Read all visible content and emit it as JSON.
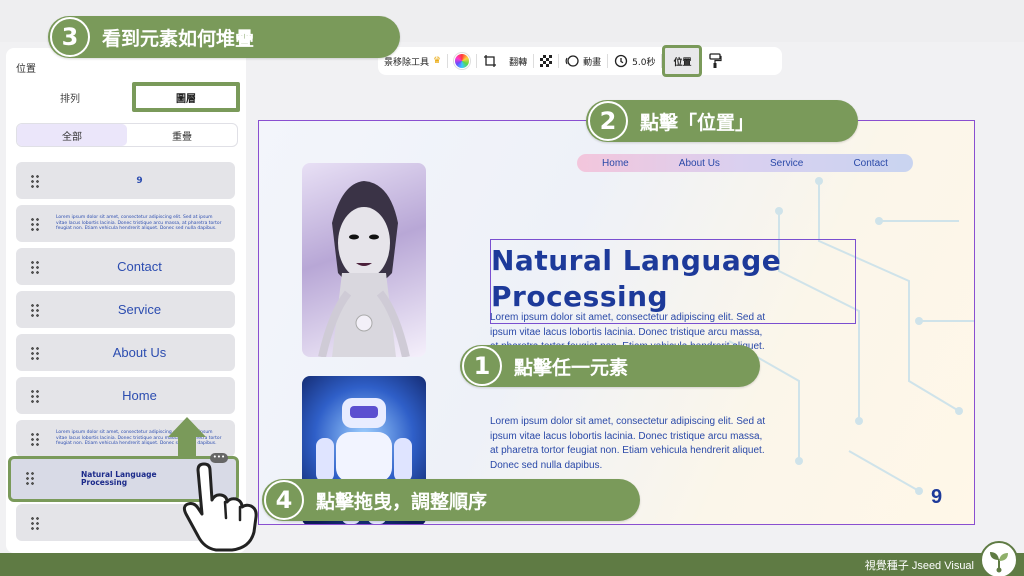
{
  "sidebar": {
    "title": "位置",
    "tabs": [
      {
        "label": "排列"
      },
      {
        "label": "圖層"
      }
    ],
    "filters": [
      {
        "label": "全部"
      },
      {
        "label": "重疊"
      }
    ],
    "layers": [
      {
        "kind": "number",
        "label": "9"
      },
      {
        "kind": "lorem",
        "label": "Lorem ipsum dolor sit amet, consectetur adipiscing elit. Sed at ipsum vitae lacus lobortis lacinia. Donec tristique arcu massa, at pharetra tortor feugiat non. Etiam vehicula hendrerit aliquet. Donec sed nulla dapibus."
      },
      {
        "kind": "text",
        "label": "Contact"
      },
      {
        "kind": "text",
        "label": "Service"
      },
      {
        "kind": "text",
        "label": "About Us"
      },
      {
        "kind": "text",
        "label": "Home"
      },
      {
        "kind": "lorem",
        "label": "Lorem ipsum dolor sit amet, consectetur adipiscing elit. Sed at ipsum vitae lacus lobortis lacinia. Donec tristique arcu massa, at pharetra tortor feugiat non. Etiam vehicula hendrerit aliquet. Donec sed nulla dapibus."
      },
      {
        "kind": "title",
        "label": "Natural Language Processing",
        "more": "•••"
      },
      {
        "kind": "empty",
        "label": ""
      }
    ]
  },
  "toolbar": {
    "bg_remover": "景移除工具",
    "crop_label": "翻轉",
    "animate_label": "動畫",
    "duration_label": "5.0秒",
    "position_label": "位置"
  },
  "canvas": {
    "nav": [
      "Home",
      "About Us",
      "Service",
      "Contact"
    ],
    "title": "Natural Language Processing",
    "paragraph_1_lines": [
      "Lorem ipsum dolor sit amet, consectetur adipiscing elit. Sed at",
      "ipsum vitae lacus lobortis lacinia. Donec tristique arcu massa,",
      "at pharetra tortor feugiat non. Etiam vehicula hendrerit aliquet."
    ],
    "paragraph_2_lines": [
      "Lorem ipsum dolor sit amet, consectetur adipiscing elit. Sed at",
      "ipsum vitae lacus lobortis lacinia. Donec tristique arcu massa,",
      "at pharetra tortor feugiat non. Etiam vehicula hendrerit aliquet.",
      "Donec sed nulla dapibus."
    ],
    "page_number": "9"
  },
  "steps": [
    {
      "number": "1",
      "label": "點擊任一元素"
    },
    {
      "number": "2",
      "label": "點擊「位置」"
    },
    {
      "number": "3",
      "label": "看到元素如何堆疊"
    },
    {
      "number": "4",
      "label": "點擊拖曳，調整順序"
    }
  ],
  "brand": {
    "name": "視覺種子 Jseed Visual"
  },
  "colors": {
    "accent_green": "#7a9a5a",
    "brand_green": "#5f7b44",
    "title_blue": "#1d3a9a",
    "selection_purple": "#7a4fd0"
  }
}
